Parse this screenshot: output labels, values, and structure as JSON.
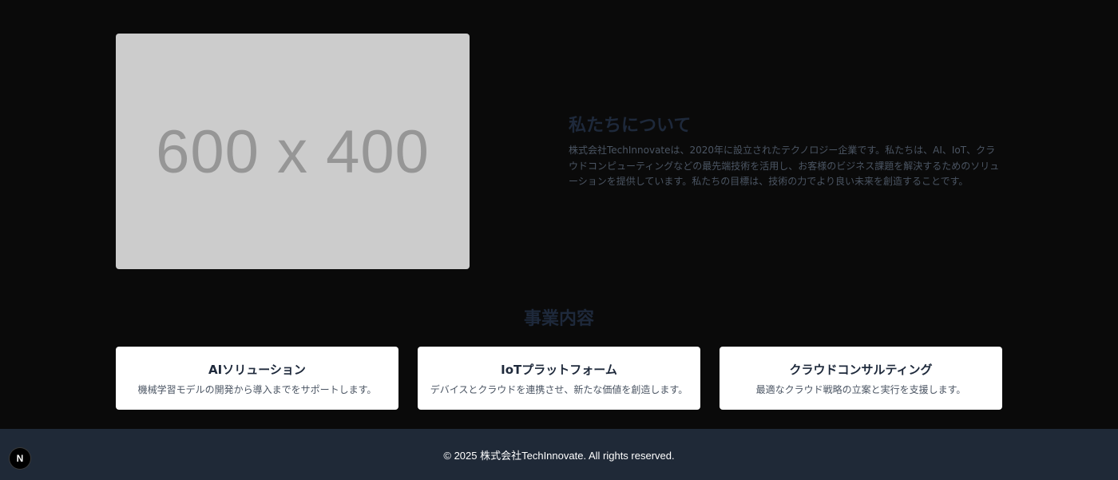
{
  "about": {
    "image_placeholder_text": "600 x 400",
    "title": "私たちについて",
    "text": "株式会社TechInnovateは、2020年に設立されたテクノロジー企業です。私たちは、AI、IoT、クラウドコンピューティングなどの最先端技術を活用し、お客様のビジネス課題を解決するためのソリューションを提供しています。私たちの目標は、技術の力でより良い未来を創造することです。"
  },
  "services": {
    "title": "事業内容",
    "items": [
      {
        "title": "AIソリューション",
        "description": "機械学習モデルの開発から導入までをサポートします。"
      },
      {
        "title": "IoTプラットフォーム",
        "description": "デバイスとクラウドを連携させ、新たな価値を創造します。"
      },
      {
        "title": "クラウドコンサルティング",
        "description": "最適なクラウド戦略の立案と実行を支援します。"
      }
    ]
  },
  "footer": {
    "copyright": "© 2025 株式会社TechInnovate. All rights reserved."
  },
  "dev_badge": {
    "icon": "nextjs-icon",
    "label": "N"
  }
}
